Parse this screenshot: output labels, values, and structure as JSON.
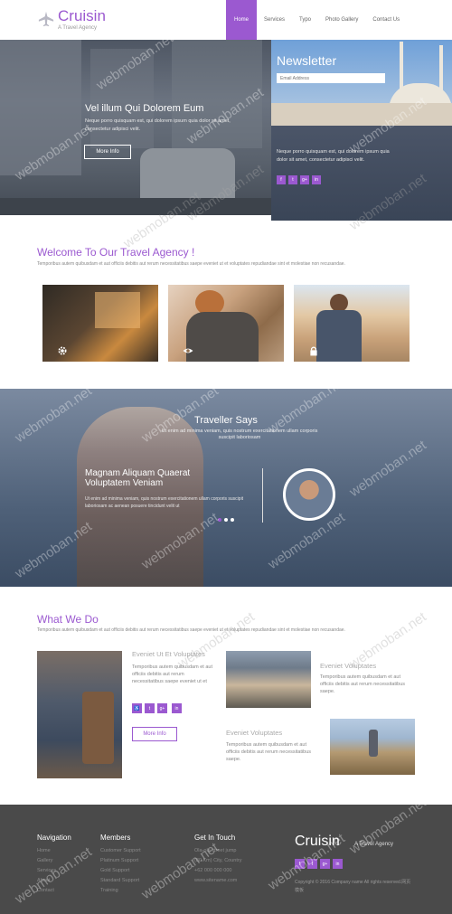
{
  "colors": {
    "accent": "#9b59d0",
    "footer_bg": "#4a4a4a"
  },
  "header": {
    "logo_icon": "plane-icon",
    "title": "Cruisin",
    "subtitle": "A Travel Agency",
    "nav": [
      "Home",
      "Services",
      "Typo",
      "Photo Gallery",
      "Contact Us"
    ]
  },
  "hero": {
    "title": "Vel illum Qui Dolorem Eum",
    "text": "Neque porro quisquam est, qui dolorem ipsum quia dolor sit amet, consectetur adipisci velit.",
    "button": "More Info"
  },
  "newsletter": {
    "title": "Newsletter",
    "placeholder": "Email Address",
    "text": "Neque porro quisquam est, qui dolorem ipsum quia dolor sit amet, consectetur adipisci velit.",
    "socials": [
      "f",
      "t",
      "g+",
      "in"
    ]
  },
  "welcome": {
    "title": "Welcome To Our Travel Agency !",
    "text": "Temporibus autem quibusdam et aut officiis debitis aut rerum necessitatibus saepe eveniet ut et voluptates repudiandae sint et molestiae non recusandae.",
    "icons": [
      "gear-icon",
      "eye-icon",
      "lock-icon"
    ]
  },
  "testimonial": {
    "title": "Traveller Says",
    "subtitle": "Ut enim ad minima veniam, quis nostrum exercitationem ullam corporis suscipit laboriosam",
    "quote_title": "Magnam Aliquam Quaerat Voluptatem Veniam",
    "quote": "Ut enim ad minima veniam, quis nostrum exercitationem ullam corporis suscipit laboriosam ac aenean posuere tincidunt velit ut"
  },
  "what_we_do": {
    "title": "What We Do",
    "text": "Temporibus autem quibusdam et aut officiis debitis aut rerum necessitatibus saepe eveniet ut et voluptates repudiandae sint et molestiae non recusandae.",
    "card1": {
      "title": "Eveniet Ut Et Voluptates",
      "text": "Temporibus autem quibusdam et aut officiis debitis aut rerum necessitatibus saepe eveniet ut et",
      "button": "More Info"
    },
    "card2": {
      "title": "Eveniet Voluptates",
      "text": "Temporibus autem quibusdam et aut officiis debitis aut rerum necessitatibus saepe."
    },
    "card3": {
      "title": "Eveniet Voluptates",
      "text": "Temporibus autem quibusdam et aut officiis debitis aut rerum necessitatibus saepe."
    }
  },
  "footer": {
    "nav_title": "Navigation",
    "nav": [
      "Home",
      "Gallery",
      "Services",
      "About",
      "Contact"
    ],
    "members_title": "Members",
    "members": [
      "Customer Support",
      "Platinum Support",
      "Gold Support",
      "Standard Support",
      "Training"
    ],
    "contact_title": "Get In Touch",
    "contact": [
      "Ola-ola street jump",
      "(80 Km) City, Country",
      "+62 000 000 000",
      "www.sitename.com"
    ],
    "logo": "Cruisin",
    "logo_sub": "A Travel Agency",
    "copyright": "Copyright © 2016 Company name All rights reserved.网页模板"
  },
  "watermark": "webmoban.net"
}
